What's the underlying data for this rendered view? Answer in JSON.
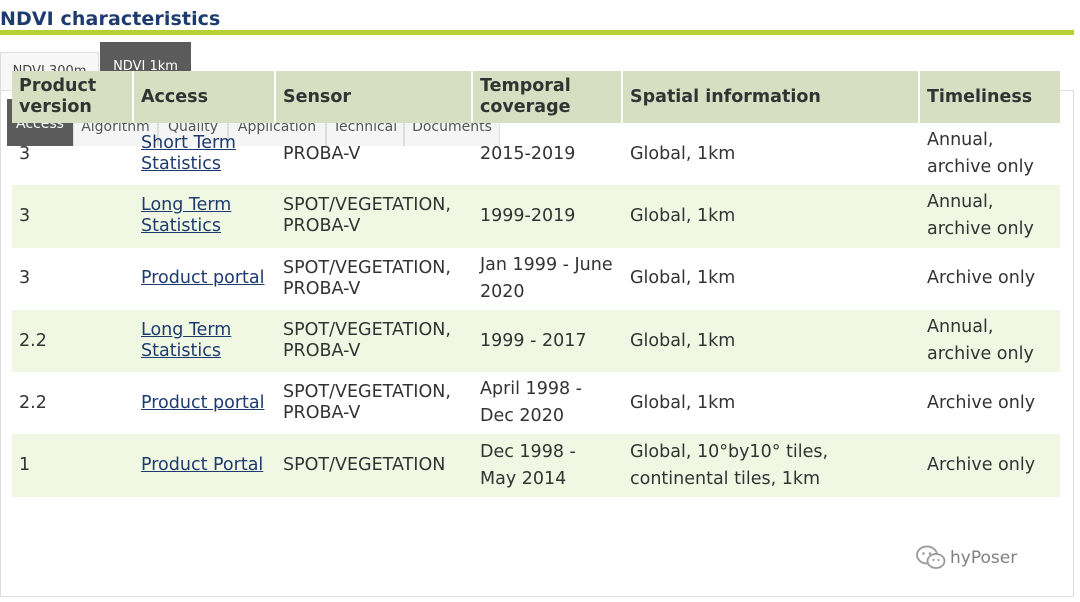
{
  "page": {
    "title": "NDVI characteristics"
  },
  "outer_tabs": [
    {
      "label": "NDVI 300m",
      "active": false
    },
    {
      "label": "NDVI 1km",
      "active": true
    }
  ],
  "inner_tabs": [
    {
      "label": "Access",
      "active": true
    },
    {
      "label": "Algorithm",
      "active": false
    },
    {
      "label": "Quality",
      "active": false
    },
    {
      "label": "Application",
      "active": false
    },
    {
      "label": "Technical",
      "active": false
    },
    {
      "label": "Documents",
      "active": false
    }
  ],
  "table": {
    "headers": [
      "Product version",
      "Access",
      "Sensor",
      "Temporal coverage",
      "Spatial information",
      "Timeliness"
    ],
    "rows": [
      {
        "version": "3",
        "access": "Short Term Statistics",
        "sensor": "PROBA-V",
        "temporal": "2015-2019",
        "spatial": "Global, 1km",
        "timeliness": "Annual, archive only"
      },
      {
        "version": "3",
        "access": "Long Term Statistics",
        "sensor": "SPOT/VEGETATION, PROBA-V",
        "temporal": "1999-2019",
        "spatial": "Global, 1km",
        "timeliness": "Annual, archive only"
      },
      {
        "version": "3",
        "access": "Product portal",
        "sensor": "SPOT/VEGETATION, PROBA-V",
        "temporal": "Jan 1999 - June 2020",
        "spatial": "Global, 1km",
        "timeliness": "Archive only"
      },
      {
        "version": "2.2",
        "access": "Long Term Statistics",
        "sensor": "SPOT/VEGETATION, PROBA-V",
        "temporal": "1999 - 2017",
        "spatial": "Global, 1km",
        "timeliness": "Annual, archive only"
      },
      {
        "version": "2.2",
        "access": "Product portal",
        "sensor": "SPOT/VEGETATION, PROBA-V",
        "temporal": "April 1998 - Dec 2020",
        "spatial": "Global, 1km",
        "timeliness": "Archive only"
      },
      {
        "version": "1",
        "access": "Product Portal",
        "sensor": "SPOT/VEGETATION",
        "temporal": "Dec 1998 - May 2014",
        "spatial": "Global, 10°by10° tiles, continental tiles, 1km",
        "timeliness": "Archive only"
      }
    ]
  },
  "watermark": {
    "text": "hyPoser"
  },
  "colors": {
    "title": "#1d3b6e",
    "rule": "#b6d134",
    "header_bg": "#d6dfc2",
    "alt_row_bg": "#f0f8e3",
    "active_tab_bg": "#5b5b5b"
  }
}
